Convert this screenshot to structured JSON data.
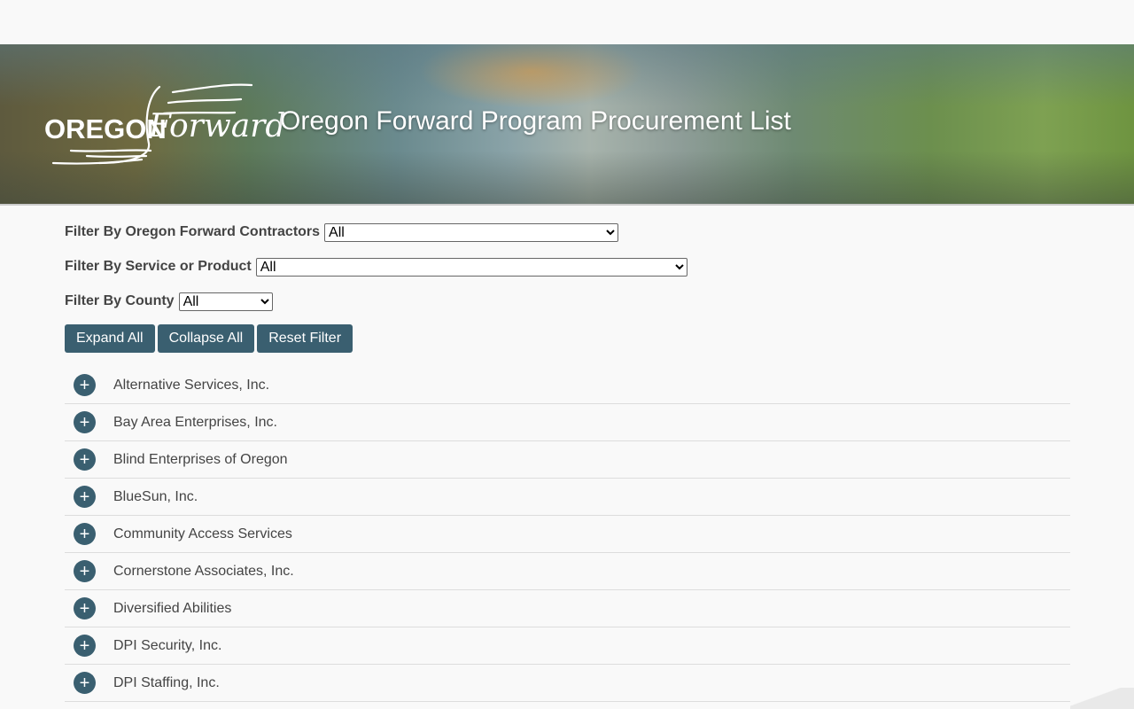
{
  "header": {
    "logo_text_1": "OREGON",
    "logo_text_2": "Forward",
    "title": "Oregon Forward Program Procurement List"
  },
  "filters": [
    {
      "label": "Filter By Oregon Forward Contractors",
      "selected": "All"
    },
    {
      "label": "Filter By Service or Product",
      "selected": "All"
    },
    {
      "label": "Filter By County",
      "selected": "All"
    }
  ],
  "buttons": {
    "expand": "Expand All",
    "collapse": "Collapse All",
    "reset": "Reset Filter"
  },
  "expand_symbol": "+",
  "contractors": [
    "Alternative Services, Inc.",
    "Bay Area Enterprises, Inc.",
    "Blind Enterprises of Oregon",
    "BlueSun, Inc.",
    "Community Access Services",
    "Cornerstone Associates, Inc.",
    "Diversified Abilities",
    "DPI Security, Inc.",
    "DPI Staffing, Inc."
  ],
  "colors": {
    "accent": "#3a5f70",
    "background": "#f9f9f9"
  }
}
